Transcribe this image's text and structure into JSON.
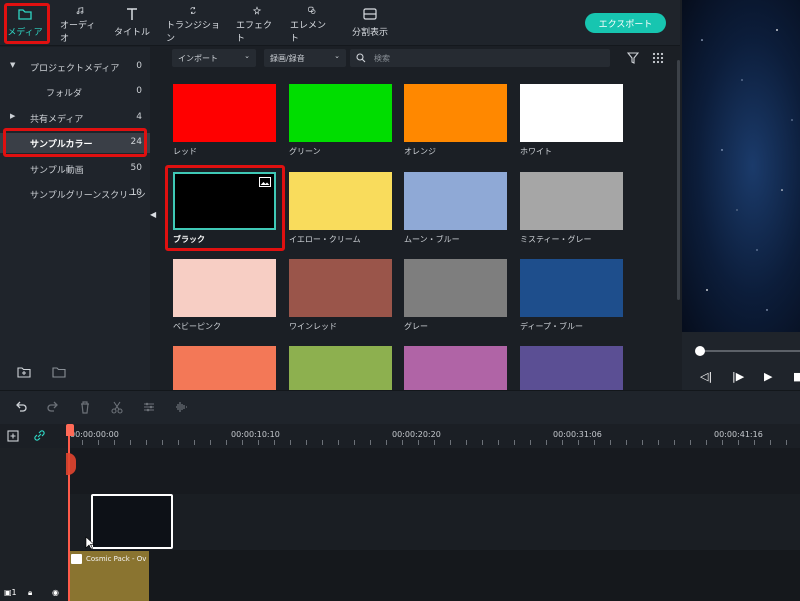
{
  "toolbar": {
    "tabs": [
      {
        "label": "メディア",
        "icon": "folder-icon"
      },
      {
        "label": "オーディオ",
        "icon": "music-note-icon"
      },
      {
        "label": "タイトル",
        "icon": "text-t-icon"
      },
      {
        "label": "トランジション",
        "icon": "transition-icon"
      },
      {
        "label": "エフェクト",
        "icon": "effect-sparkle-icon"
      },
      {
        "label": "エレメント",
        "icon": "element-icon"
      },
      {
        "label": "分割表示",
        "icon": "split-screen-icon"
      }
    ],
    "export_label": "エクスポート"
  },
  "sidebar": {
    "items": [
      {
        "label": "プロジェクトメディア",
        "count": "0"
      },
      {
        "label": "フォルダ",
        "count": "0"
      },
      {
        "label": "共有メディア",
        "count": "4"
      },
      {
        "label": "サンプルカラー",
        "count": "24"
      },
      {
        "label": "サンプル動画",
        "count": "50"
      },
      {
        "label": "サンプルグリーンスクリーン",
        "count": "10"
      }
    ]
  },
  "filters": {
    "import_label": "インポート",
    "record_label": "録画/録音",
    "search_placeholder": "検索"
  },
  "tiles": [
    {
      "label": "レッド",
      "color": "#ff0000"
    },
    {
      "label": "グリーン",
      "color": "#00dd00"
    },
    {
      "label": "オレンジ",
      "color": "#ff8800"
    },
    {
      "label": "ホワイト",
      "color": "#ffffff"
    },
    {
      "label": "ブラック",
      "color": "#000000"
    },
    {
      "label": "イエロー・クリーム",
      "color": "#f9dc5c"
    },
    {
      "label": "ムーン・ブルー",
      "color": "#8fa9d6"
    },
    {
      "label": "ミスティー・グレー",
      "color": "#a6a6a6"
    },
    {
      "label": "ベビーピンク",
      "color": "#f7cec4"
    },
    {
      "label": "ワインレッド",
      "color": "#9a554a"
    },
    {
      "label": "グレー",
      "color": "#7e7e7e"
    },
    {
      "label": "ディープ・ブルー",
      "color": "#1e4e8c"
    },
    {
      "label": "",
      "color": "#f37857"
    },
    {
      "label": "",
      "color": "#8db04f"
    },
    {
      "label": "",
      "color": "#b064a6"
    },
    {
      "label": "",
      "color": "#5b4f94"
    }
  ],
  "timeline": {
    "timecodes": [
      "00:00:00:00",
      "00:00:10:10",
      "00:00:20:20",
      "00:00:31:06",
      "00:00:41:16"
    ],
    "clip_name": "Cosmic Pack - Ov"
  },
  "colors": {
    "accent": "#17c5b0",
    "highlight": "#e01010",
    "playhead": "#ff5b4a"
  }
}
